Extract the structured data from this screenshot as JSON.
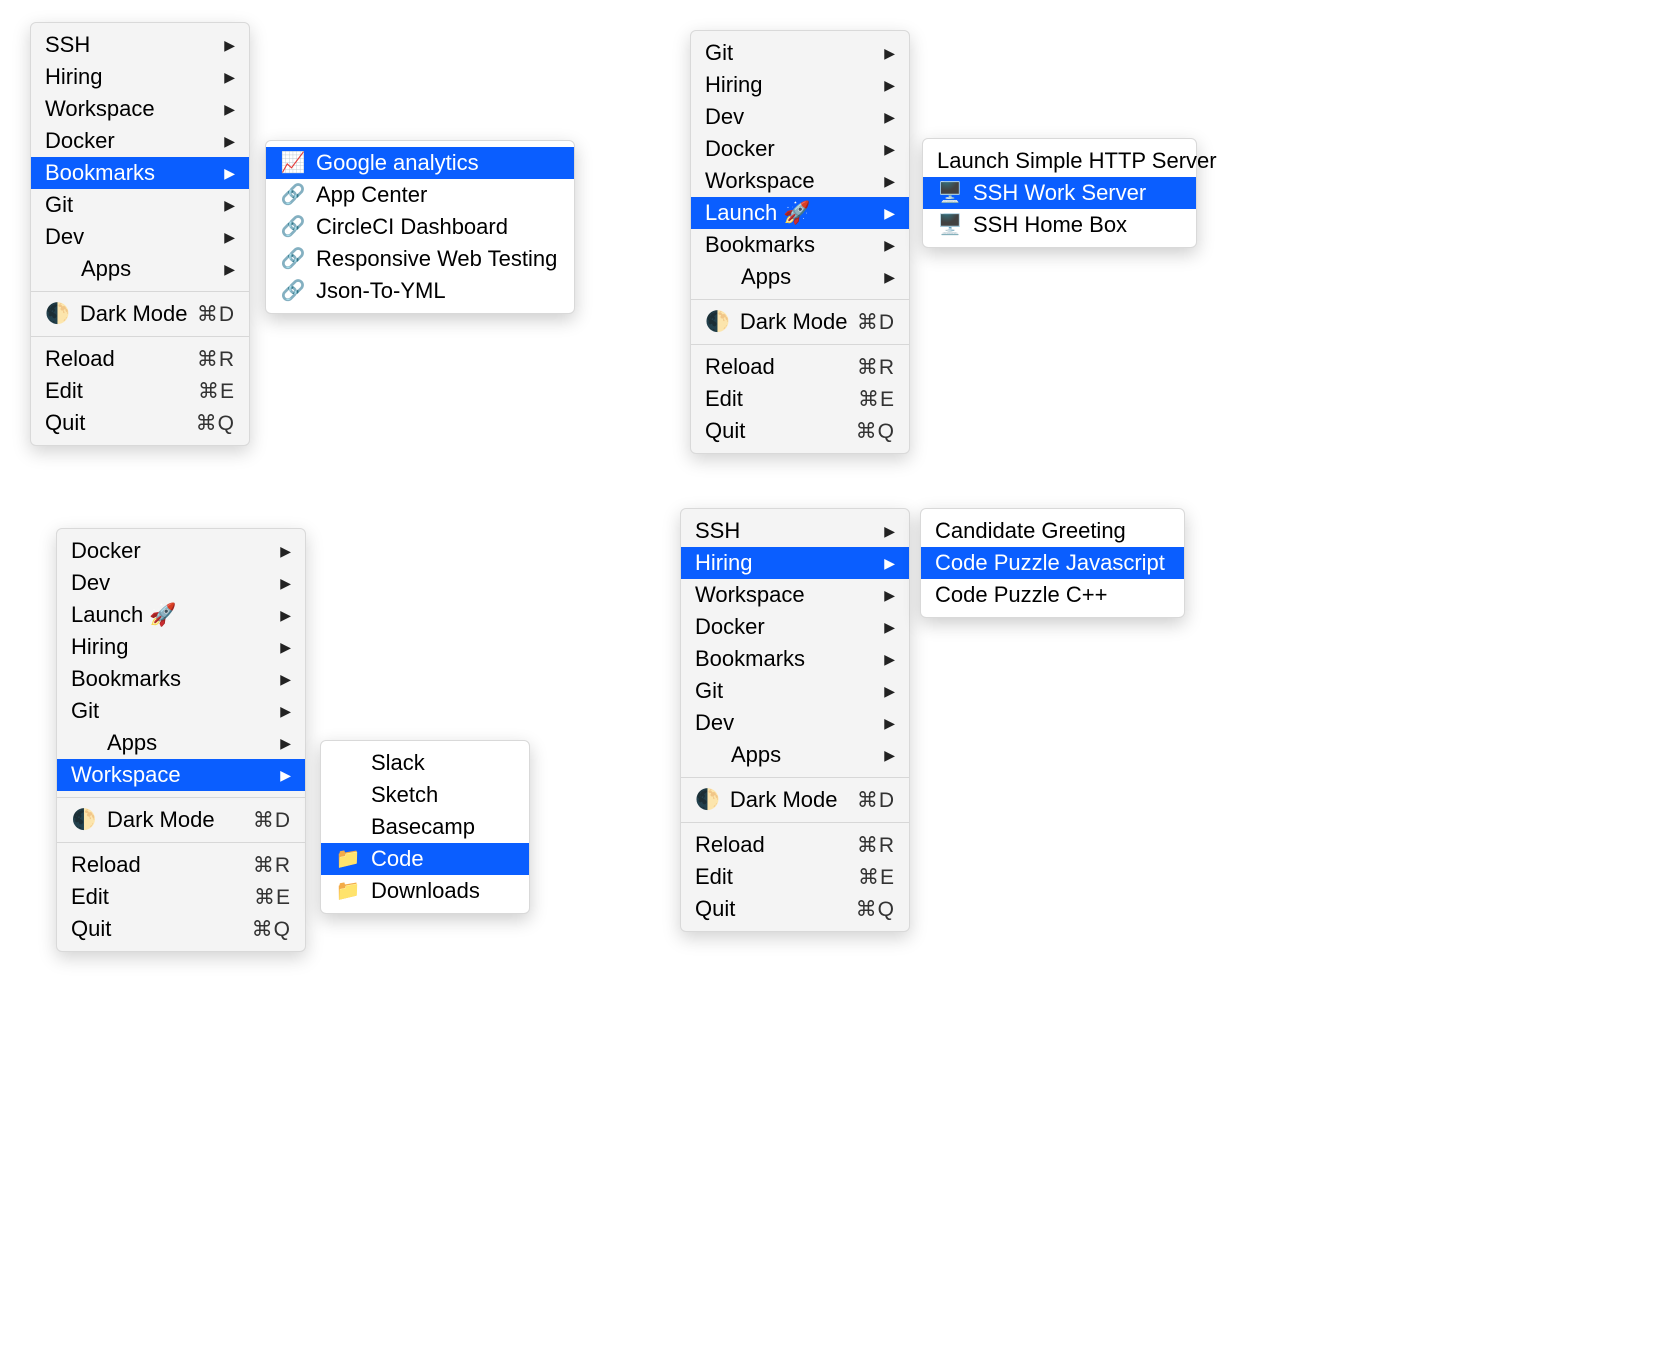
{
  "colors": {
    "selection": "#0a5eff"
  },
  "labels": {
    "dark_mode": "Dark Mode",
    "reload": "Reload",
    "edit": "Edit",
    "quit": "Quit"
  },
  "shortcuts": {
    "dark_mode": "⌘D",
    "reload": "⌘R",
    "edit": "⌘E",
    "quit": "⌘Q"
  },
  "panel_a": {
    "main": [
      "SSH",
      "Hiring",
      "Workspace",
      "Docker",
      "Bookmarks",
      "Git",
      "Dev",
      "Apps"
    ],
    "selected": "Bookmarks",
    "submenu": {
      "title": "Bookmarks",
      "items": [
        "Google analytics",
        "App Center",
        "CircleCI Dashboard",
        "Responsive Web Testing",
        "Json-To-YML"
      ],
      "selected": "Google analytics"
    }
  },
  "panel_b": {
    "main": [
      "Git",
      "Hiring",
      "Dev",
      "Docker",
      "Workspace",
      "Launch 🚀",
      "Bookmarks",
      "Apps"
    ],
    "selected": "Launch 🚀",
    "submenu": {
      "title": "Launch",
      "items": [
        "Launch Simple HTTP Server",
        "SSH Work Server",
        "SSH Home Box"
      ],
      "selected": "SSH Work Server"
    }
  },
  "panel_c": {
    "main": [
      "Docker",
      "Dev",
      "Launch 🚀",
      "Hiring",
      "Bookmarks",
      "Git",
      "Apps",
      "Workspace"
    ],
    "selected": "Workspace",
    "submenu": {
      "title": "Workspace",
      "items": [
        "Slack",
        "Sketch",
        "Basecamp",
        "Code",
        "Downloads"
      ],
      "selected": "Code"
    }
  },
  "panel_d": {
    "main": [
      "SSH",
      "Hiring",
      "Workspace",
      "Docker",
      "Bookmarks",
      "Git",
      "Dev",
      "Apps"
    ],
    "selected": "Hiring",
    "submenu": {
      "title": "Hiring",
      "items": [
        "Candidate Greeting",
        "Code Puzzle Javascript",
        "Code Puzzle C++"
      ],
      "selected": "Code Puzzle Javascript"
    }
  }
}
